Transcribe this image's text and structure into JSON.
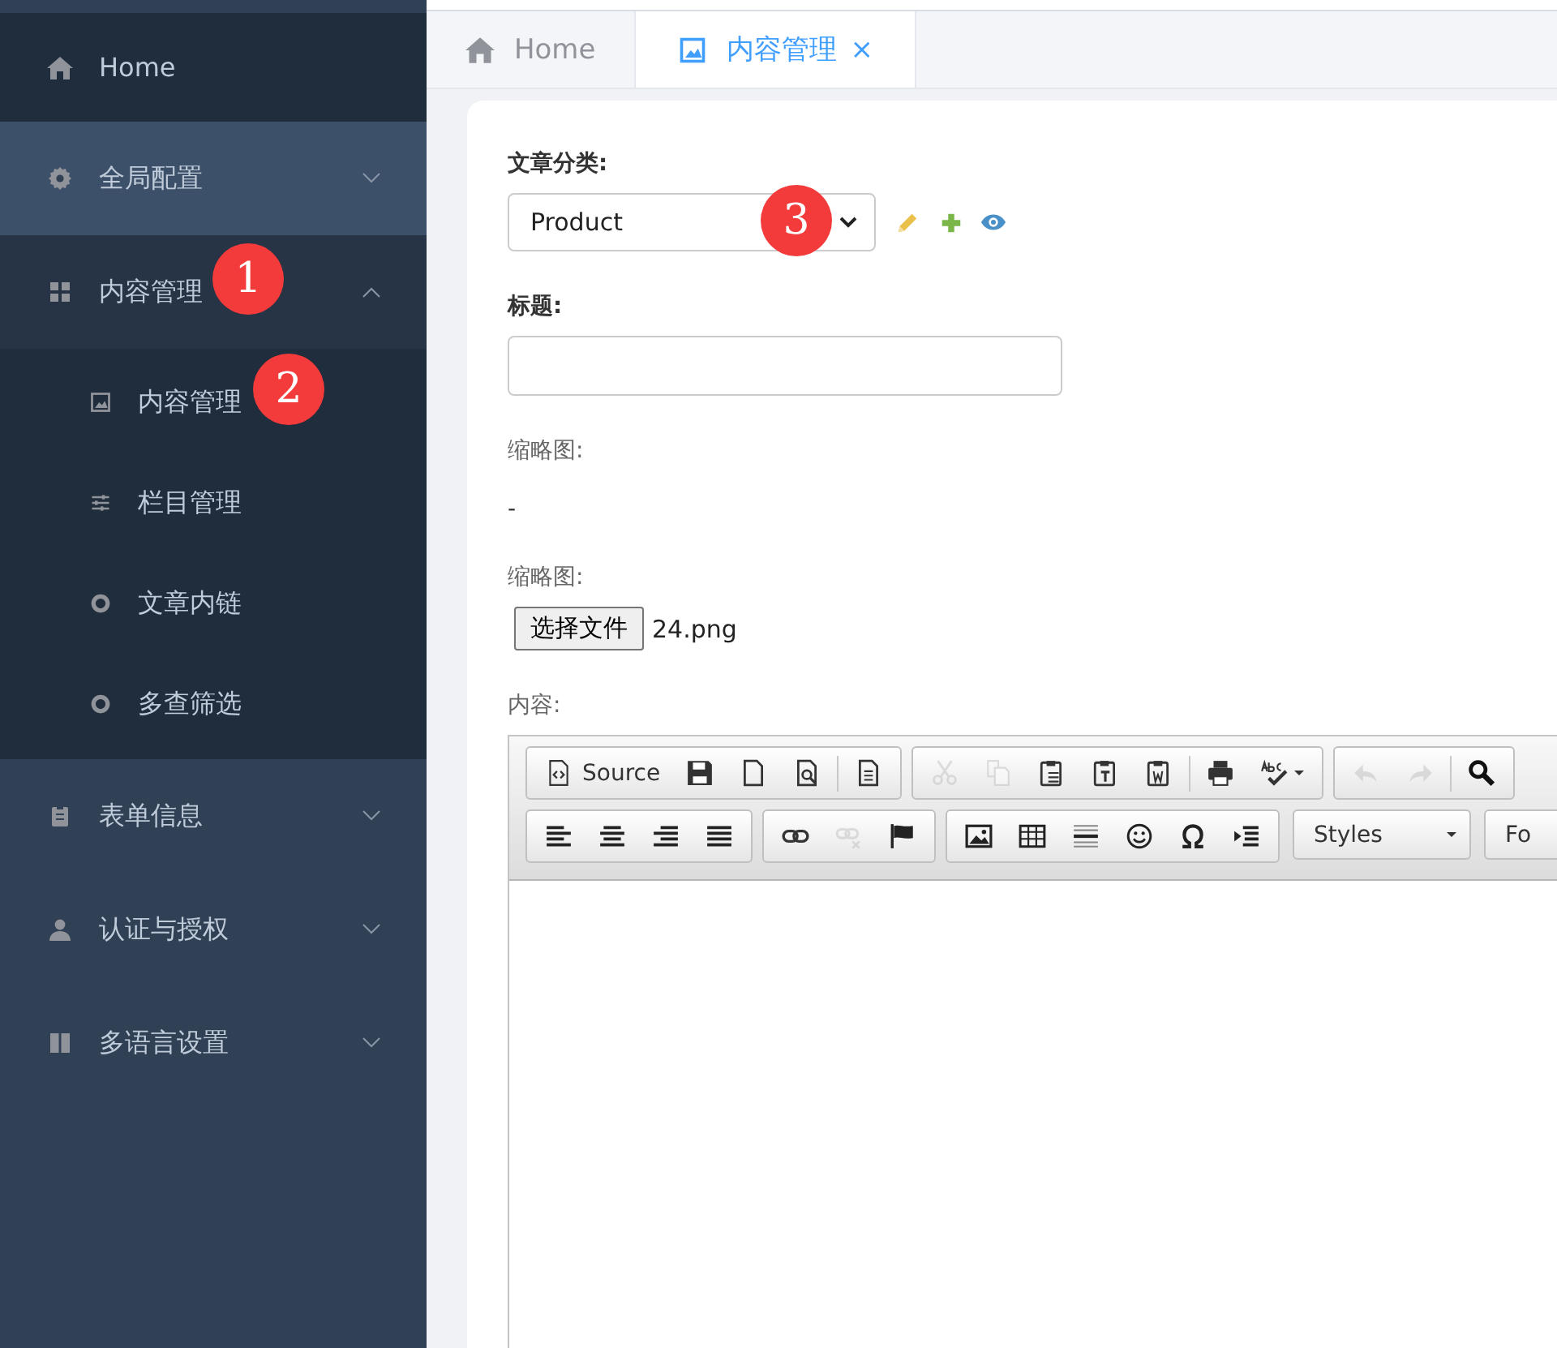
{
  "sidebar": {
    "items": [
      {
        "label": "Home",
        "kind": "link",
        "highlighted": false
      },
      {
        "label": "全局配置",
        "kind": "group",
        "expanded": false,
        "highlighted": true
      },
      {
        "label": "内容管理",
        "kind": "group",
        "expanded": true,
        "highlighted": false,
        "children": [
          {
            "label": "内容管理"
          },
          {
            "label": "栏目管理"
          },
          {
            "label": "文章内链"
          },
          {
            "label": "多查筛选"
          }
        ]
      },
      {
        "label": "表单信息",
        "kind": "group",
        "expanded": false,
        "highlighted": false
      },
      {
        "label": "认证与授权",
        "kind": "group",
        "expanded": false,
        "highlighted": false
      },
      {
        "label": "多语言设置",
        "kind": "group",
        "expanded": false,
        "highlighted": false
      }
    ]
  },
  "tabs": [
    {
      "label": "Home",
      "selected": false
    },
    {
      "label": "内容管理",
      "selected": true,
      "close": "×"
    }
  ],
  "form": {
    "category_label": "文章分类:",
    "category_value": "Product",
    "title_label": "标题:",
    "thumb_label": "缩略图:",
    "thumb_value": "-",
    "upload_label": "缩略图:",
    "upload_button": "选择文件",
    "upload_file": "24.png",
    "content_label": "内容:"
  },
  "editor": {
    "rows": [
      [
        [
          {
            "kind": "source",
            "label": "Source",
            "disabled": false
          },
          {
            "kind": "save",
            "disabled": false
          },
          {
            "kind": "newpage",
            "disabled": false
          },
          {
            "kind": "preview",
            "disabled": false
          },
          {
            "kind": "sep"
          },
          {
            "kind": "templates",
            "disabled": false
          }
        ],
        [
          {
            "kind": "cut",
            "disabled": true
          },
          {
            "kind": "copy",
            "disabled": true
          },
          {
            "kind": "paste",
            "disabled": false
          },
          {
            "kind": "pastetext",
            "disabled": false
          },
          {
            "kind": "pasteword",
            "disabled": false
          },
          {
            "kind": "sep"
          },
          {
            "kind": "print",
            "disabled": false
          },
          {
            "kind": "spell",
            "disabled": false
          }
        ],
        [
          {
            "kind": "undo",
            "disabled": true
          },
          {
            "kind": "redo",
            "disabled": true
          },
          {
            "kind": "sep"
          },
          {
            "kind": "find",
            "disabled": false
          }
        ]
      ],
      [
        [
          {
            "kind": "alignleft",
            "disabled": false
          },
          {
            "kind": "aligncenter",
            "disabled": false
          },
          {
            "kind": "alignright",
            "disabled": false
          },
          {
            "kind": "justify",
            "disabled": false
          }
        ],
        [
          {
            "kind": "link",
            "disabled": false
          },
          {
            "kind": "unlink",
            "disabled": true
          },
          {
            "kind": "anchor",
            "disabled": false
          }
        ],
        [
          {
            "kind": "image",
            "disabled": false
          },
          {
            "kind": "table",
            "disabled": false
          },
          {
            "kind": "hr",
            "disabled": false
          },
          {
            "kind": "smiley",
            "disabled": false
          },
          {
            "kind": "omega",
            "disabled": false
          },
          {
            "kind": "pagebreak",
            "disabled": false
          }
        ],
        [
          {
            "kind": "combo",
            "label": "Styles"
          }
        ],
        [
          {
            "kind": "combo",
            "label": "Fo"
          }
        ]
      ]
    ]
  },
  "annotations": [
    {
      "number": "1"
    },
    {
      "number": "2"
    },
    {
      "number": "3"
    }
  ]
}
